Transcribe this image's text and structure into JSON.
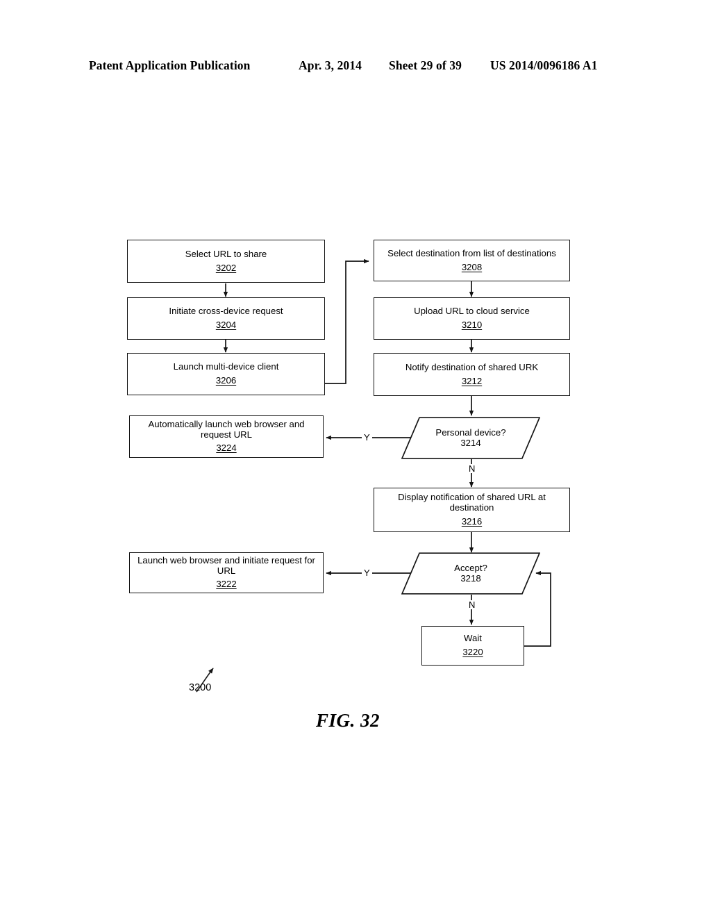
{
  "header": {
    "publication": "Patent Application Publication",
    "date": "Apr. 3, 2014",
    "sheet": "Sheet 29 of 39",
    "patent_number": "US 2014/0096186 A1"
  },
  "figure": {
    "caption": "FIG. 32",
    "lead_reference": "3200",
    "nodes": [
      {
        "id": "n3202",
        "shape": "rect",
        "label": "Select URL to share",
        "ref": "3202"
      },
      {
        "id": "n3204",
        "shape": "rect",
        "label": "Initiate cross-device request",
        "ref": "3204"
      },
      {
        "id": "n3206",
        "shape": "rect",
        "label": "Launch multi-device client",
        "ref": "3206"
      },
      {
        "id": "n3208",
        "shape": "rect",
        "label": "Select destination from list of destinations",
        "ref": "3208"
      },
      {
        "id": "n3210",
        "shape": "rect",
        "label": "Upload URL to cloud service",
        "ref": "3210"
      },
      {
        "id": "n3212",
        "shape": "rect",
        "label": "Notify destination of shared URK",
        "ref": "3212"
      },
      {
        "id": "n3214",
        "shape": "parallelogram",
        "label": "Personal device?",
        "ref": "3214"
      },
      {
        "id": "n3216",
        "shape": "rect",
        "label": "Display notification of shared URL at destination",
        "ref": "3216"
      },
      {
        "id": "n3218",
        "shape": "parallelogram",
        "label": "Accept?",
        "ref": "3218"
      },
      {
        "id": "n3220",
        "shape": "rect",
        "label": "Wait",
        "ref": "3220"
      },
      {
        "id": "n3222",
        "shape": "rect",
        "label": "Launch web browser and initiate request for URL",
        "ref": "3222"
      },
      {
        "id": "n3224",
        "shape": "rect",
        "label": "Automatically launch web browser and request URL",
        "ref": "3224"
      }
    ],
    "edge_labels": {
      "personal_device_yes": "Y",
      "personal_device_no": "N",
      "accept_yes": "Y",
      "accept_no": "N"
    },
    "line_color": "#141414"
  }
}
